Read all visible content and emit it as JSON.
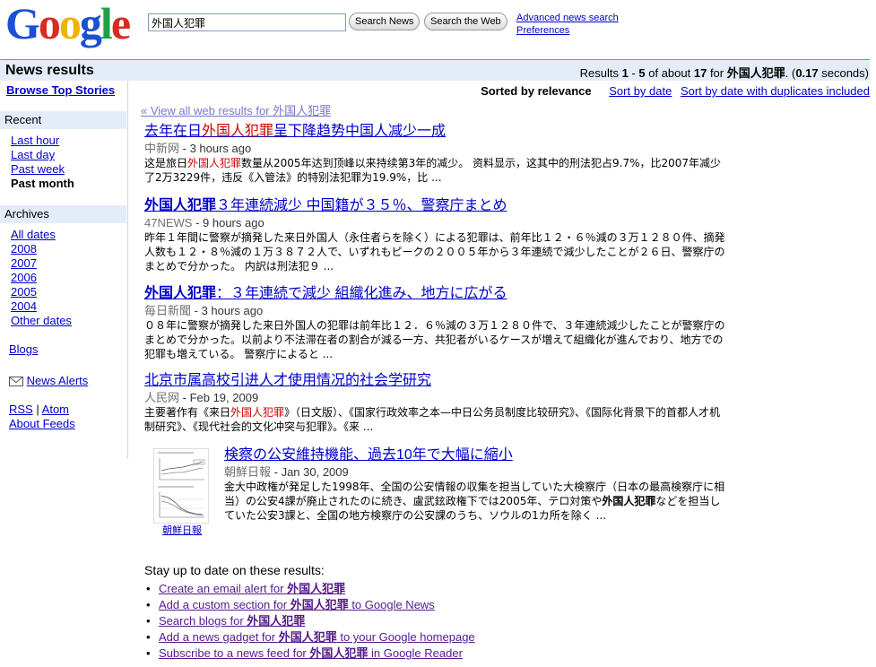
{
  "header": {
    "logo": "Google",
    "search_value": "外国人犯罪",
    "search_news_label": "Search News",
    "search_web_label": "Search the Web",
    "advanced_link": "Advanced news search",
    "preferences_link": "Preferences"
  },
  "results_bar": {
    "title": "News results",
    "stats_prefix": "Results ",
    "stats_range_start": "1",
    "stats_dash": " - ",
    "stats_range_end": "5",
    "stats_of": " of about ",
    "stats_total": "17",
    "stats_for": " for ",
    "stats_query": "外国人犯罪",
    "stats_dot": ". (",
    "stats_time": "0.17",
    "stats_seconds": " seconds)"
  },
  "sidebar": {
    "browse_top": "Browse Top Stories",
    "recent_head": "Recent",
    "recent_items": [
      "Last hour",
      "Last day",
      "Past week",
      "Past month"
    ],
    "archives_head": "Archives",
    "archive_items": [
      "All dates",
      "2008",
      "2007",
      "2006",
      "2005",
      "2004",
      "Other dates"
    ],
    "blogs": "Blogs",
    "news_alerts": "News Alerts",
    "rss": "RSS",
    "sep": "|",
    "atom": "Atom",
    "about_feeds": "About Feeds"
  },
  "sort": {
    "current": "Sorted by relevance",
    "by_date": "Sort by date",
    "by_date_dup": "Sort by date with duplicates included"
  },
  "view_all": "« View all web results for 外国人犯罪",
  "results": [
    {
      "title_a": "去年在日",
      "title_hl": "外国人犯罪",
      "title_b": "呈下降趋势中国人减少一成",
      "source": "中新网",
      "time": " - 3 hours ago",
      "snippet_a": "这是旅日",
      "snippet_hl": "外国人犯罪",
      "snippet_b": "数量从2005年达到顶峰以来持续第3年的减少。 资料显示，这其中的刑法犯占9.7%，比2007年减少了2万3229件，违反《入管法》的特别法犯罪为19.9%，比 ..."
    },
    {
      "title_hl": "外国人犯罪",
      "title_b": "３年連続減少 中国籍が３５％、警察庁まとめ",
      "source": "47NEWS",
      "time": " - 9 hours ago",
      "snippet": "昨年１年間に警察が摘発した来日外国人（永住者らを除く）による犯罪は、前年比１２・６％減の３万１２８０件、摘発人数も１２・８％減の１万３８７２人で、いずれもピークの２００５年から３年連続で減少したことが２６日、警察庁のまとめで分かった。 内訳は刑法犯９ ..."
    },
    {
      "title_hl": "外国人犯罪",
      "title_b": "：３年連続で減少 組織化進み、地方に広がる",
      "source": "毎日新聞",
      "time": " - 3 hours ago",
      "snippet": "０８年に警察が摘発した来日外国人の犯罪は前年比１２．６％減の３万１２８０件で、３年連続減少したことが警察庁のまとめで分かった。以前より不法滞在者の割合が減る一方、共犯者がいるケースが増えて組織化が進んでおり、地方での犯罪も増えている。 警察庁によると ..."
    },
    {
      "title": "北京市属高校引进人才使用情况的社会学研究",
      "source": "人民网",
      "time": " - Feb 19, 2009",
      "snippet_a": "主要著作有《来日",
      "snippet_hl": "外国人犯罪",
      "snippet_b": "》（日文版）、《国家行政效率之本—中日公务员制度比较研究》、《国际化背景下的首都人才机制研究》、《现代社会的文化冲突与犯罪》。《来 ..."
    },
    {
      "title": "検察の公安維持機能、過去10年で大幅に縮小",
      "source": "朝鮮日報",
      "time": " - Jan 30, 2009",
      "snippet_a": "金大中政権が発足した1998年、全国の公安情報の収集を担当していた大検察庁（日本の最高検察庁に相当）の公安4課が廃止されたのに続き、盧武鉉政権下では2005年、テロ対策や",
      "snippet_bold": "外国人犯罪",
      "snippet_b": "などを担当していた公安3課と、全国の地方検察庁の公安課のうち、ソウルの1カ所を除く ...",
      "thumb_caption": "朝鮮日報"
    }
  ],
  "stay": {
    "head": "Stay up to date on these results:",
    "items": [
      {
        "a": "Create an email alert for ",
        "q": "外国人犯罪",
        "b": ""
      },
      {
        "a": "Add a custom section for ",
        "q": "外国人犯罪",
        "b": " to Google News"
      },
      {
        "a": "Search blogs for ",
        "q": "外国人犯罪",
        "b": ""
      },
      {
        "a": "Add a news gadget for ",
        "q": "外国人犯罪",
        "b": " to your Google homepage"
      },
      {
        "a": "Subscribe to a news feed for ",
        "q": "外国人犯罪",
        "b": " in Google Reader"
      }
    ]
  },
  "colors": {
    "link": "#0000cc",
    "visited": "#551a8b",
    "highlight": "#cc0000",
    "bar_bg": "#e5ecf9"
  }
}
